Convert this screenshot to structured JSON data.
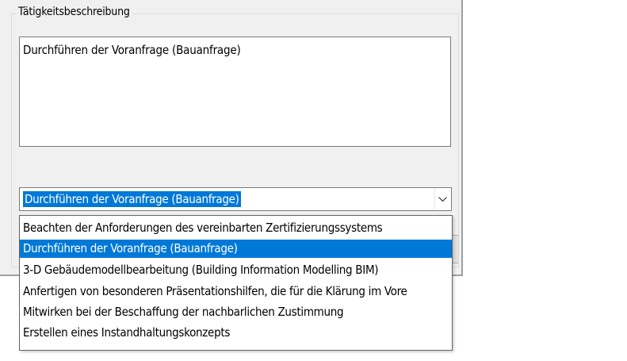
{
  "groupbox": {
    "title": "Tätigkeitsbeschreibung"
  },
  "description": {
    "text": "Durchführen der Voranfrage (Bauanfrage)"
  },
  "combobox": {
    "selected_value": "Durchführen der Voranfrage (Bauanfrage)",
    "arrow_icon": "chevron-down-icon"
  },
  "dropdown": {
    "selected_index": 1,
    "items": [
      {
        "label": "Beachten der Anforderungen des vereinbarten Zertifizierungssystems"
      },
      {
        "label": "Durchführen der Voranfrage (Bauanfrage)"
      },
      {
        "label": "3-D Gebäudemodellbearbeitung (Building Information Modelling BIM)"
      },
      {
        "label": "Anfertigen von besonderen Präsentationshilfen, die für die Klärung im Vore"
      },
      {
        "label": "Mitwirken bei der Beschaffung der nachbarlichen Zustimmung"
      },
      {
        "label": "Erstellen eines Instandhaltungskonzepts"
      }
    ]
  },
  "colors": {
    "selection": "#0078d7",
    "dialog_background": "#f0f0f0"
  }
}
